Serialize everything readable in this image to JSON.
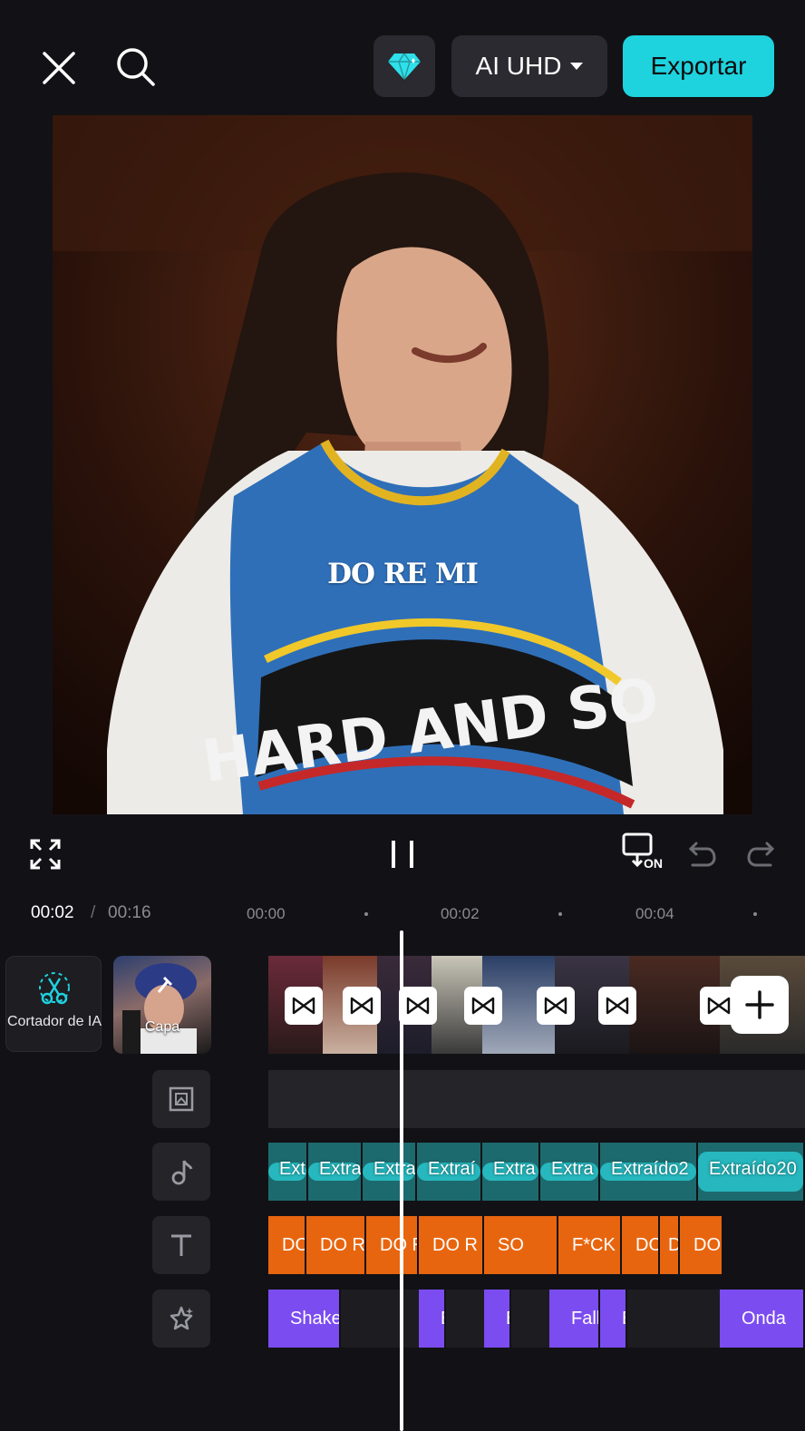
{
  "header": {
    "quality_label": "AI UHD",
    "export_label": "Exportar",
    "icons": {
      "close": "close-icon",
      "search": "search-icon",
      "pro": "diamond-icon"
    },
    "accent_color": "#1ed2de"
  },
  "preview": {
    "overlay_text": "DO RE MI",
    "shirt_text": "HARD AND SO"
  },
  "controls": {
    "fullscreen": "fullscreen-icon",
    "pause": "pause-icon",
    "pip_badge": "ON",
    "undo": "undo-icon",
    "redo": "redo-icon"
  },
  "timeline": {
    "current_time": "00:02",
    "separator": "/",
    "total_time": "00:16",
    "ruler_ticks": [
      "00:00",
      "00:02",
      "00:04"
    ],
    "ai_cutter_label": "Cortador de IA",
    "cover_label": "Capa",
    "audio_clips": [
      "Ext",
      "Extra",
      "Extra",
      "Extraí",
      "Extra",
      "Extra",
      "Extraído2",
      "Extraído20"
    ],
    "text_clips": [
      "DO",
      "DO R",
      "DO R",
      "DO R",
      "SO",
      "F*CK",
      "DO",
      "D",
      "DO"
    ],
    "effect_clips": [
      "Shake",
      "E",
      "E",
      "Fall",
      "E",
      "Onda"
    ],
    "track_icons": [
      "overlay-icon",
      "music-icon",
      "text-icon",
      "effects-icon"
    ]
  }
}
